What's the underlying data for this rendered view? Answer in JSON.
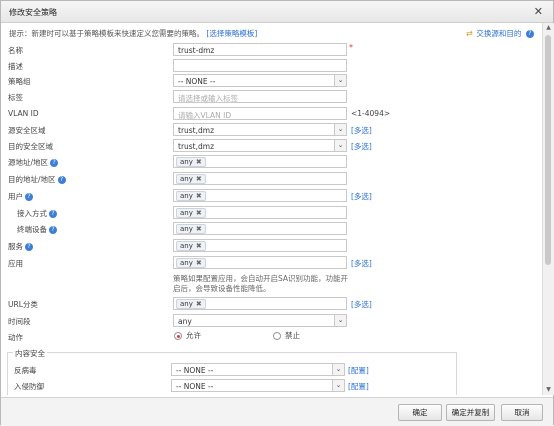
{
  "dialog": {
    "title": "修改安全策略"
  },
  "hint": {
    "text": "提示：新建时可以基于策略模板来快速定义您需要的策略。",
    "link": "[选择策略模板]"
  },
  "swap_label": "交换源和目的",
  "fields": {
    "name": {
      "label": "名称",
      "value": "trust-dmz",
      "required": "*"
    },
    "desc": {
      "label": "描述",
      "value": ""
    },
    "policy_group": {
      "label": "策略组",
      "value": "-- NONE --"
    },
    "tag": {
      "label": "标签",
      "placeholder": "请选择或输入标签"
    },
    "vlan": {
      "label": "VLAN ID",
      "placeholder": "请输入VLAN ID",
      "range": "<1-4094>"
    },
    "src_zone": {
      "label": "源安全区域",
      "value": "trust,dmz",
      "multi": "[多选]"
    },
    "dst_zone": {
      "label": "目的安全区域",
      "value": "trust,dmz",
      "multi": "[多选]"
    },
    "src_addr": {
      "label": "源地址/地区",
      "tag": "any"
    },
    "dst_addr": {
      "label": "目的地址/地区",
      "tag": "any"
    },
    "user": {
      "label": "用户",
      "tag": "any",
      "multi": "[多选]"
    },
    "access": {
      "label": "接入方式",
      "tag": "any"
    },
    "terminal": {
      "label": "终端设备",
      "tag": "any"
    },
    "service": {
      "label": "服务",
      "tag": "any"
    },
    "app": {
      "label": "应用",
      "tag": "any",
      "multi": "[多选]",
      "note": "策略如果配置应用，会自动开启SA识别功能，功能开启后，会导致设备性能降低。"
    },
    "url": {
      "label": "URL分类",
      "tag": "any",
      "multi": "[多选]"
    },
    "time": {
      "label": "时间段",
      "value": "any"
    },
    "action": {
      "label": "动作",
      "allow": "允许",
      "deny": "禁止"
    }
  },
  "content_security": {
    "legend": "内容安全",
    "antivirus": {
      "label": "反病毒",
      "value": "-- NONE --",
      "config": "[配置]"
    },
    "ips": {
      "label": "入侵防御",
      "value": "-- NONE --",
      "config": "[配置]"
    }
  },
  "footer": {
    "ok": "确定",
    "ok_copy": "确定并复制",
    "cancel": "取消"
  },
  "colors": {
    "link": "#2a6fd6",
    "required": "#e03a3a"
  },
  "icons": {
    "close": "close-icon",
    "help": "help-icon",
    "swap": "swap-icon"
  }
}
